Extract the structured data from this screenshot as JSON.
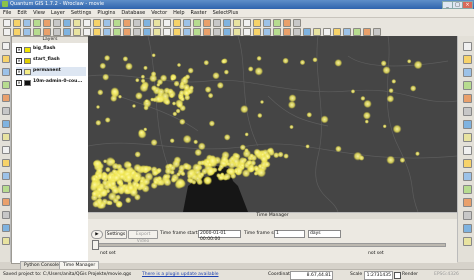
{
  "window": {
    "title": "Quantum GIS 1.7.2 - Wroclaw - movie"
  },
  "menu": [
    "File",
    "Edit",
    "View",
    "Layer",
    "Settings",
    "Plugins",
    "Database",
    "Vector",
    "Help",
    "Raster",
    "SelectPlus"
  ],
  "layers_panel": {
    "title": "Layers",
    "layers": [
      {
        "name": "big_flash",
        "checked": true,
        "color": "#f3e600"
      },
      {
        "name": "start_flash",
        "checked": true,
        "color": "#e0d000"
      },
      {
        "name": "permanent",
        "checked": true,
        "color": "#f4ee87"
      },
      {
        "name": "10m-admin-0-cou...",
        "checked": true,
        "color": "#111111"
      }
    ]
  },
  "time_manager": {
    "title": "Time Manager",
    "settings_label": "Settings",
    "export_label": "Export Video",
    "start_label": "Time frame start:",
    "start_value": "2000-01-01 00:00:00",
    "size_label": "Time frame size:",
    "size_value": "1",
    "unit_value": "days",
    "not_set_a": "not set",
    "not_set_b": "not set"
  },
  "tabs": [
    "Python Console",
    "Time Manager"
  ],
  "status": {
    "saved_text": "Saved project to: C:/Users/anita/QGis Projekte/movie.qgs",
    "plugin_link": "There is a plugin update available",
    "coordinate_label": "Coordinate:",
    "coordinate_value": "8.67,44.81",
    "scale_label": "Scale",
    "scale_value": "1:2731435",
    "render_label": "Render",
    "epsg_label": "EPSG:4326"
  },
  "colors": {
    "map_bg": "#454545",
    "flash": "#f5ef6a",
    "land": "#161616"
  }
}
